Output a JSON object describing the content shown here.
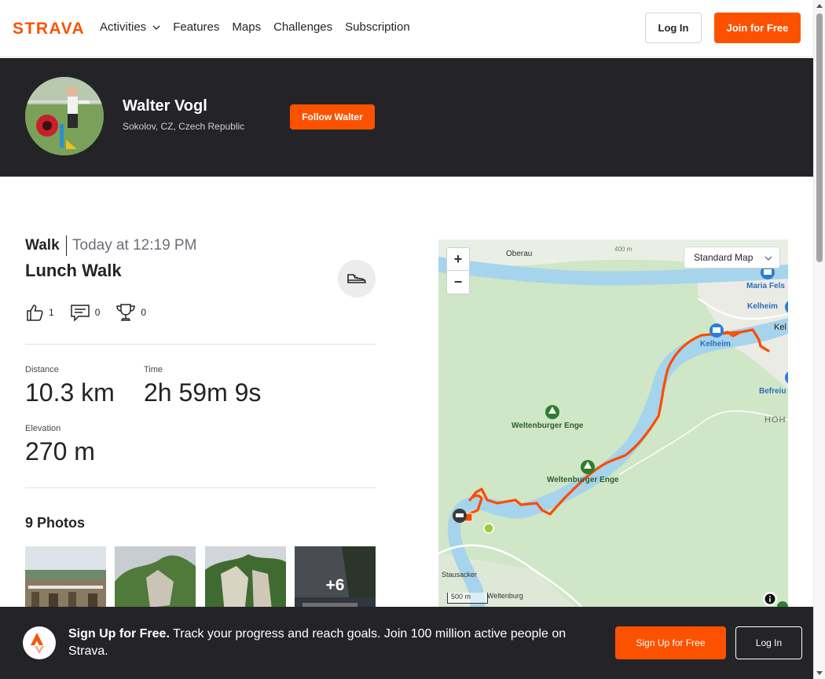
{
  "nav": {
    "logo_text": "STRAVA",
    "links": [
      "Activities",
      "Features",
      "Maps",
      "Challenges",
      "Subscription"
    ],
    "login_label": "Log In",
    "join_label": "Join for Free"
  },
  "athlete": {
    "name": "Walter Vogl",
    "location": "Sokolov, CZ, Czech Republic",
    "follow_label": "Follow Walter"
  },
  "activity": {
    "type": "Walk",
    "date": "Today at 12:19 PM",
    "title": "Lunch Walk",
    "kudos": "1",
    "comments": "0",
    "achievements": "0",
    "stats": {
      "distance_label": "Distance",
      "distance_value": "10.3 km",
      "time_label": "Time",
      "time_value": "2h 59m 9s",
      "elevation_label": "Elevation",
      "elevation_value": "270 m"
    }
  },
  "photos": {
    "title": "9 Photos",
    "more_label": "+6"
  },
  "map": {
    "style_label": "Standard Map",
    "zoom_in": "+",
    "zoom_out": "−",
    "scale_label": "500 m",
    "places": {
      "oberau": "Oberau",
      "maria": "Maria Fels",
      "kelheim1": "Kelheim",
      "kel": "Kel",
      "kelheim2": "Kelheim",
      "befreiung": "Befreiu",
      "hoh": "HOH",
      "enge1": "Weltenburger Enge",
      "enge2": "Weltenburger Enge",
      "stausacker": "Stausacker",
      "weltenburg": "Weltenburg",
      "contour": "400 m"
    }
  },
  "banner": {
    "headline": "Sign Up for Free.",
    "text": " Track your progress and reach goals. Join 100 million active people on Strava.",
    "signup_label": "Sign Up for Free",
    "login_label": "Log In"
  },
  "colors": {
    "brand": "#fc5200",
    "dark": "#242428",
    "map_green": "#cde8c8",
    "river": "#a6d4ec",
    "route": "#fc4c02"
  }
}
